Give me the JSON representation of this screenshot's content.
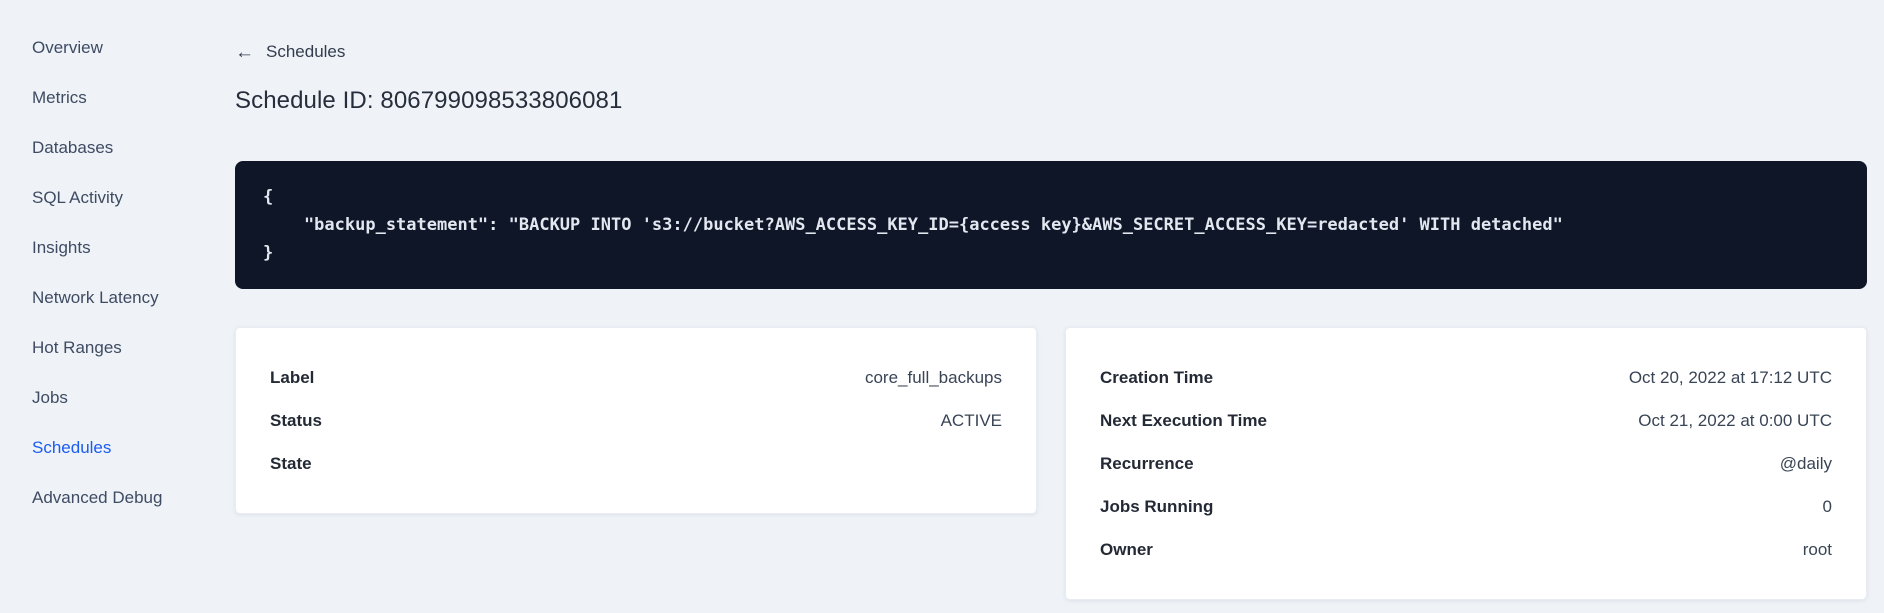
{
  "colors": {
    "page_bg": "#eff3f7",
    "accent": "#1a5cf0",
    "code_bg": "#0f1628",
    "code_text": "#e2e7f0",
    "text_dark": "#262d3b",
    "text_sidebar": "#3e4b63",
    "card_bg": "#ffffff"
  },
  "sidebar": {
    "items": [
      {
        "label": "Overview",
        "name": "sidebar-item-overview",
        "active": false
      },
      {
        "label": "Metrics",
        "name": "sidebar-item-metrics",
        "active": false
      },
      {
        "label": "Databases",
        "name": "sidebar-item-databases",
        "active": false
      },
      {
        "label": "SQL Activity",
        "name": "sidebar-item-sql-activity",
        "active": false
      },
      {
        "label": "Insights",
        "name": "sidebar-item-insights",
        "active": false
      },
      {
        "label": "Network Latency",
        "name": "sidebar-item-network-latency",
        "active": false
      },
      {
        "label": "Hot Ranges",
        "name": "sidebar-item-hot-ranges",
        "active": false
      },
      {
        "label": "Jobs",
        "name": "sidebar-item-jobs",
        "active": false
      },
      {
        "label": "Schedules",
        "name": "sidebar-item-schedules",
        "active": true
      },
      {
        "label": "Advanced Debug",
        "name": "sidebar-item-advanced-debug",
        "active": false
      }
    ]
  },
  "header": {
    "back_label": "Schedules",
    "title": "Schedule ID: 806799098533806081"
  },
  "code_block": {
    "lines": [
      "{",
      "    \"backup_statement\": \"BACKUP INTO 's3://bucket?AWS_ACCESS_KEY_ID={access key}&AWS_SECRET_ACCESS_KEY=redacted' WITH detached\"",
      "}"
    ]
  },
  "details_left": {
    "rows": [
      {
        "label": "Label",
        "value": "core_full_backups"
      },
      {
        "label": "Status",
        "value": "ACTIVE"
      },
      {
        "label": "State",
        "value": ""
      }
    ]
  },
  "details_right": {
    "rows": [
      {
        "label": "Creation Time",
        "value": "Oct 20, 2022 at 17:12 UTC"
      },
      {
        "label": "Next Execution Time",
        "value": "Oct 21, 2022 at 0:00 UTC"
      },
      {
        "label": "Recurrence",
        "value": "@daily"
      },
      {
        "label": "Jobs Running",
        "value": "0"
      },
      {
        "label": "Owner",
        "value": "root"
      }
    ]
  }
}
